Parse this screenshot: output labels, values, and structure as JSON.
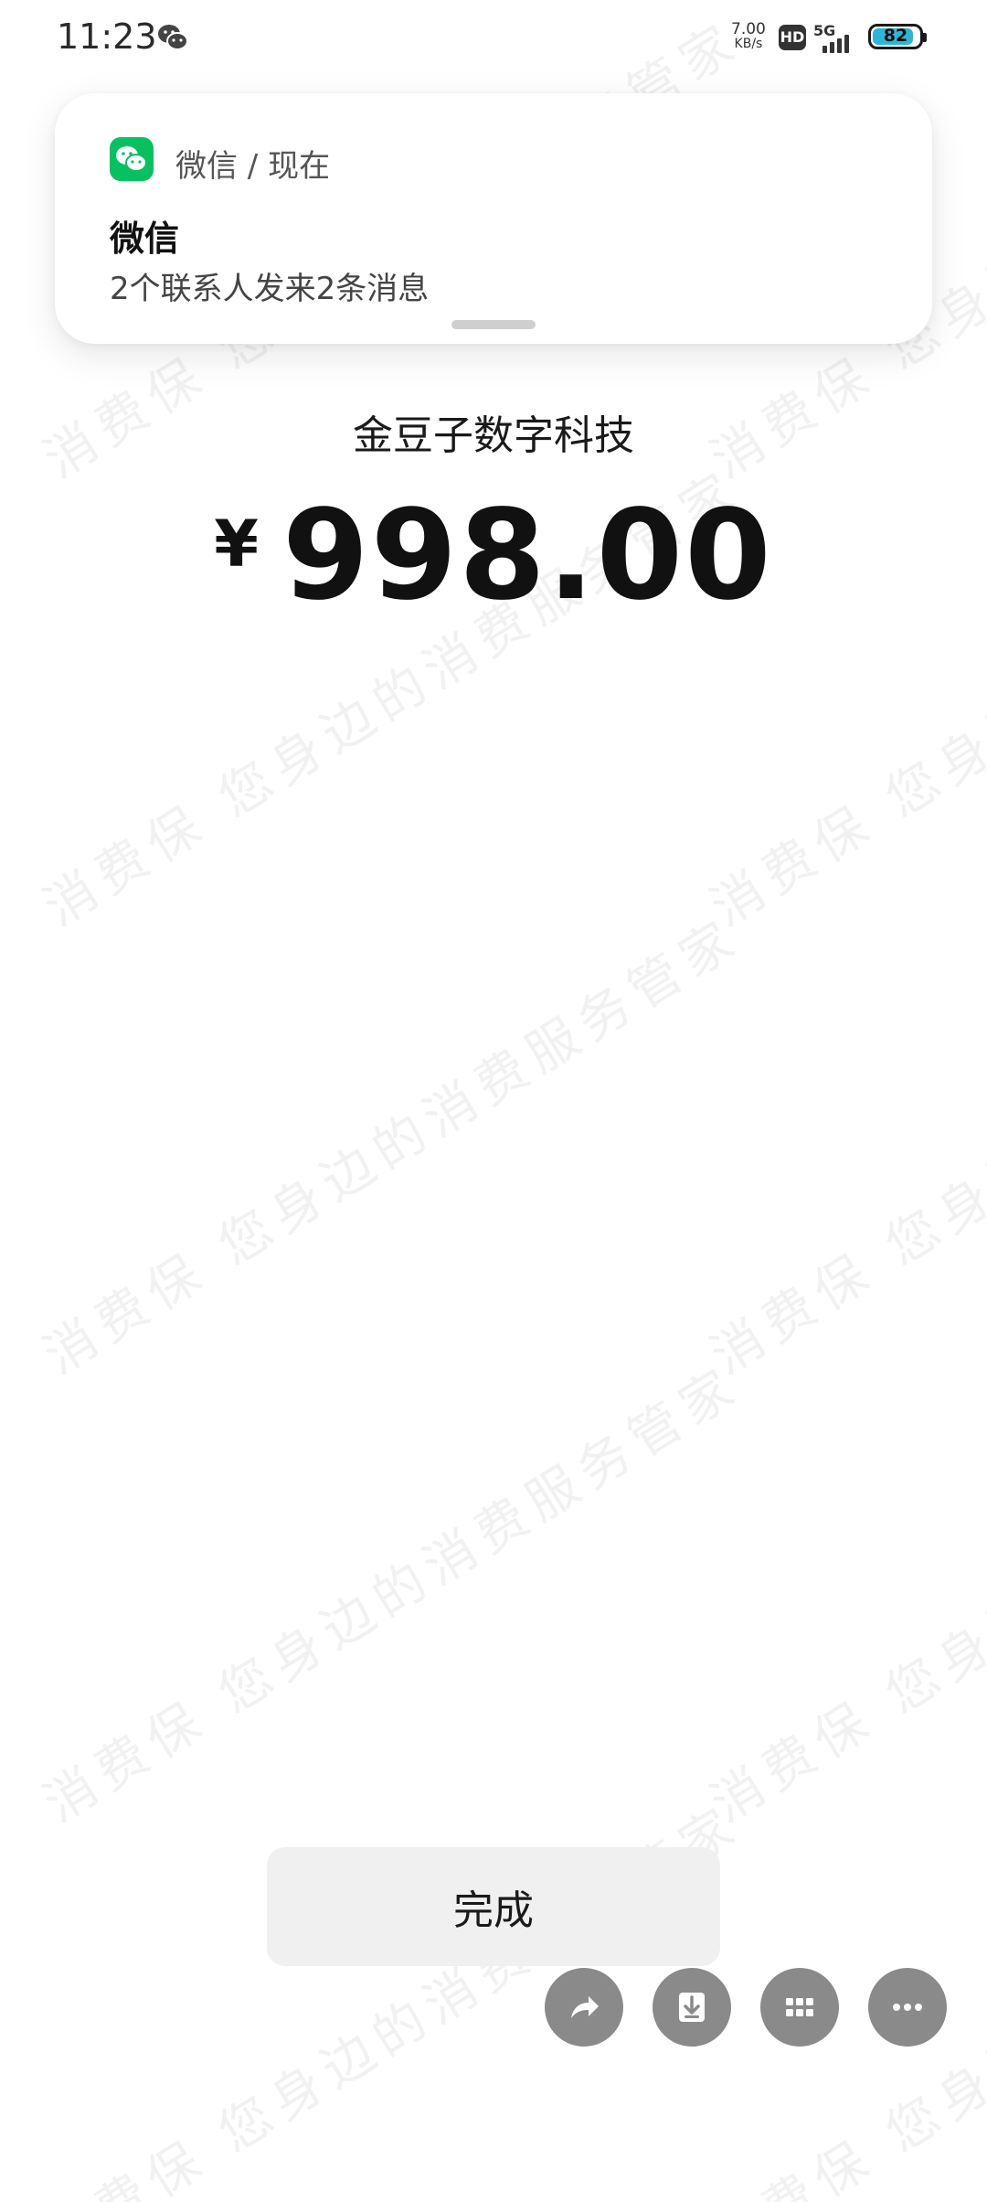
{
  "status_bar": {
    "time": "11:23",
    "net_speed_value": "7.00",
    "net_speed_unit": "KB/s",
    "hd": "HD",
    "network": "5G",
    "battery": "82",
    "battery_level": 0.82
  },
  "notification": {
    "app": "微信 / 现在",
    "title": "微信",
    "body": "2个联系人发来2条消息"
  },
  "payment": {
    "merchant": "金豆子数字科技",
    "currency": "¥",
    "amount": "998.00"
  },
  "done_button": "完成",
  "watermark": "消费保 您身边的消费服务管家",
  "floating_actions": [
    "share-icon",
    "download-icon",
    "grid-icon",
    "more-icon"
  ],
  "colors": {
    "wechat_green": "#07c160",
    "battery": "#2db5d9",
    "fab": "#8a8a8a"
  }
}
